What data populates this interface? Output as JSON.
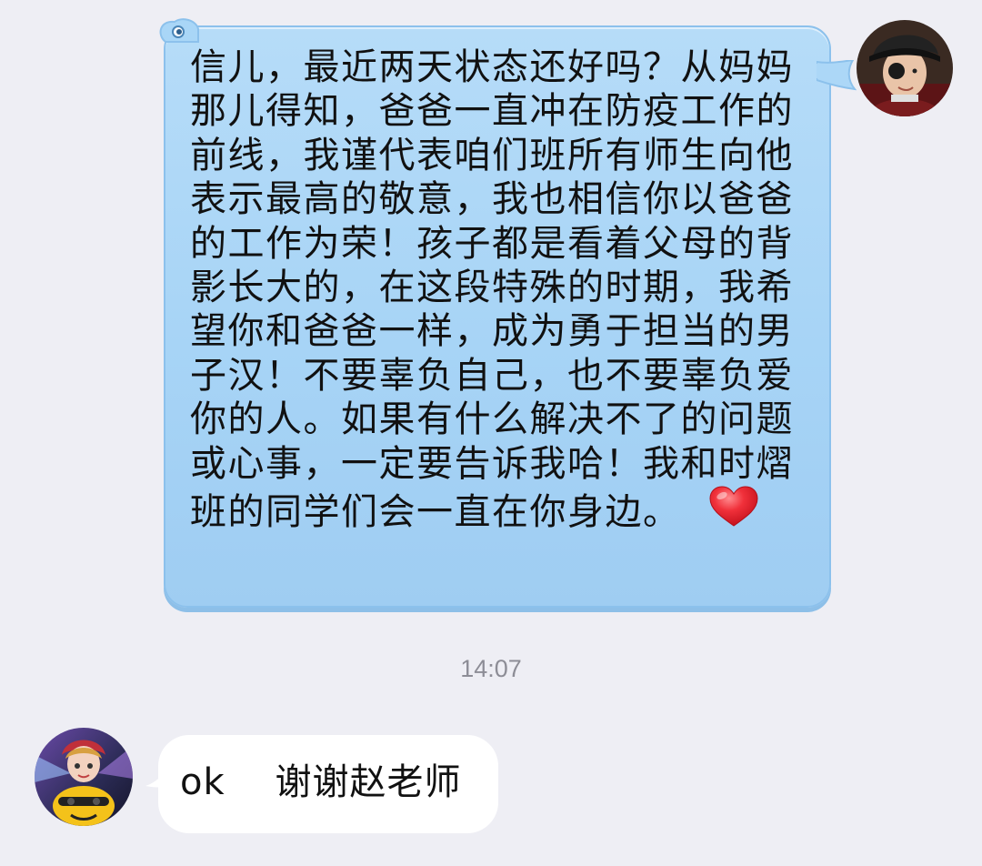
{
  "chat": {
    "sent_message": {
      "text": "信儿，最近两天状态还好吗？从妈妈那儿得知，爸爸一直冲在防疫工作的前线，我谨代表咱们班所有师生向他表示最高的敬意，我也相信你以爸爸的工作为荣！孩子都是看着父母的背影长大的，在这段特殊的时期，我希望你和爸爸一样，成为勇于担当的男子汉！不要辜负自己，也不要辜负爱你的人。如果有什么解决不了的问题或心事，一定要告诉我哈！我和时熠班的同学们会一直在你身边。",
      "emoji": "heart-icon",
      "bubble_color": "#a7d4f6",
      "sender_avatar": "teacher-avatar"
    },
    "timestamp": "14:07",
    "received_message": {
      "text": "ok    谢谢赵老师",
      "bubble_color": "#ffffff",
      "sender_avatar": "student-avatar"
    }
  },
  "colors": {
    "background": "#eeeef4",
    "heart": "#e8202a",
    "timestamp": "#8d8d96"
  }
}
